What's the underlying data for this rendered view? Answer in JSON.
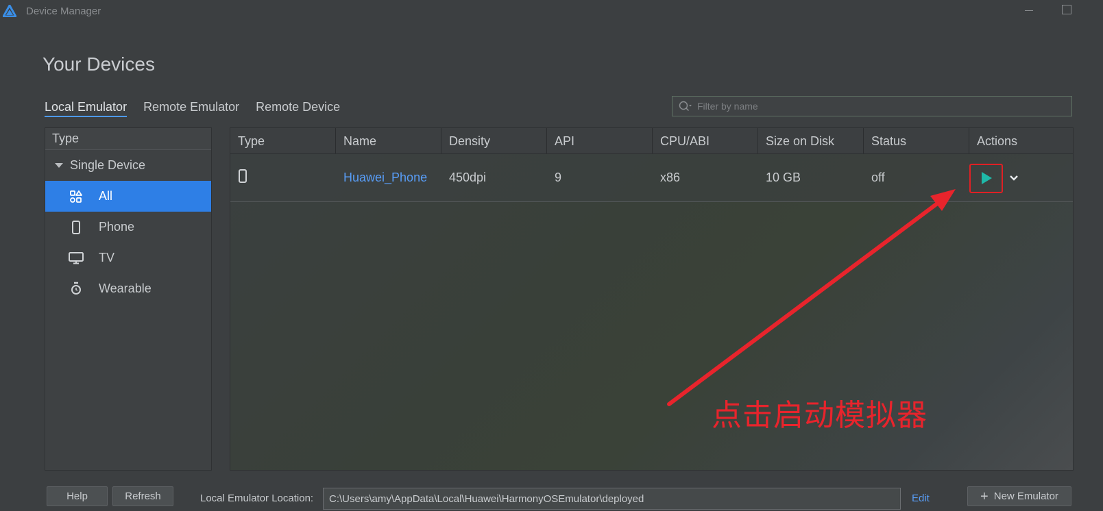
{
  "window": {
    "title": "Device Manager"
  },
  "page": {
    "title": "Your Devices"
  },
  "tabs": [
    {
      "label": "Local Emulator",
      "active": true
    },
    {
      "label": "Remote Emulator",
      "active": false
    },
    {
      "label": "Remote Device",
      "active": false
    }
  ],
  "filter": {
    "placeholder": "Filter by name",
    "value": ""
  },
  "sidebar": {
    "header": "Type",
    "group": "Single Device",
    "items": [
      {
        "label": "All",
        "icon": "all-grid-icon",
        "selected": true
      },
      {
        "label": "Phone",
        "icon": "phone-icon",
        "selected": false
      },
      {
        "label": "TV",
        "icon": "tv-icon",
        "selected": false
      },
      {
        "label": "Wearable",
        "icon": "watch-icon",
        "selected": false
      }
    ]
  },
  "table": {
    "columns": [
      "Type",
      "Name",
      "Density",
      "API",
      "CPU/ABI",
      "Size on Disk",
      "Status",
      "Actions"
    ],
    "rows": [
      {
        "type_icon": "phone-icon",
        "name": "Huawei_Phone",
        "density": "450dpi",
        "api": "9",
        "cpu": "x86",
        "size": "10 GB",
        "status": "off"
      }
    ]
  },
  "annotation": {
    "text": "点击启动模拟器",
    "color": "#e8242c"
  },
  "footer": {
    "help_label": "Help",
    "refresh_label": "Refresh",
    "location_label": "Local Emulator Location:",
    "location_value": "C:\\Users\\amy\\AppData\\Local\\Huawei\\HarmonyOSEmulator\\deployed",
    "edit_label": "Edit",
    "new_emulator_label": "New Emulator"
  },
  "colors": {
    "background": "#3c3f41",
    "accent": "#2e7fe6",
    "link": "#589df6",
    "play": "#1fb8a8",
    "highlight_box": "#e02024"
  }
}
